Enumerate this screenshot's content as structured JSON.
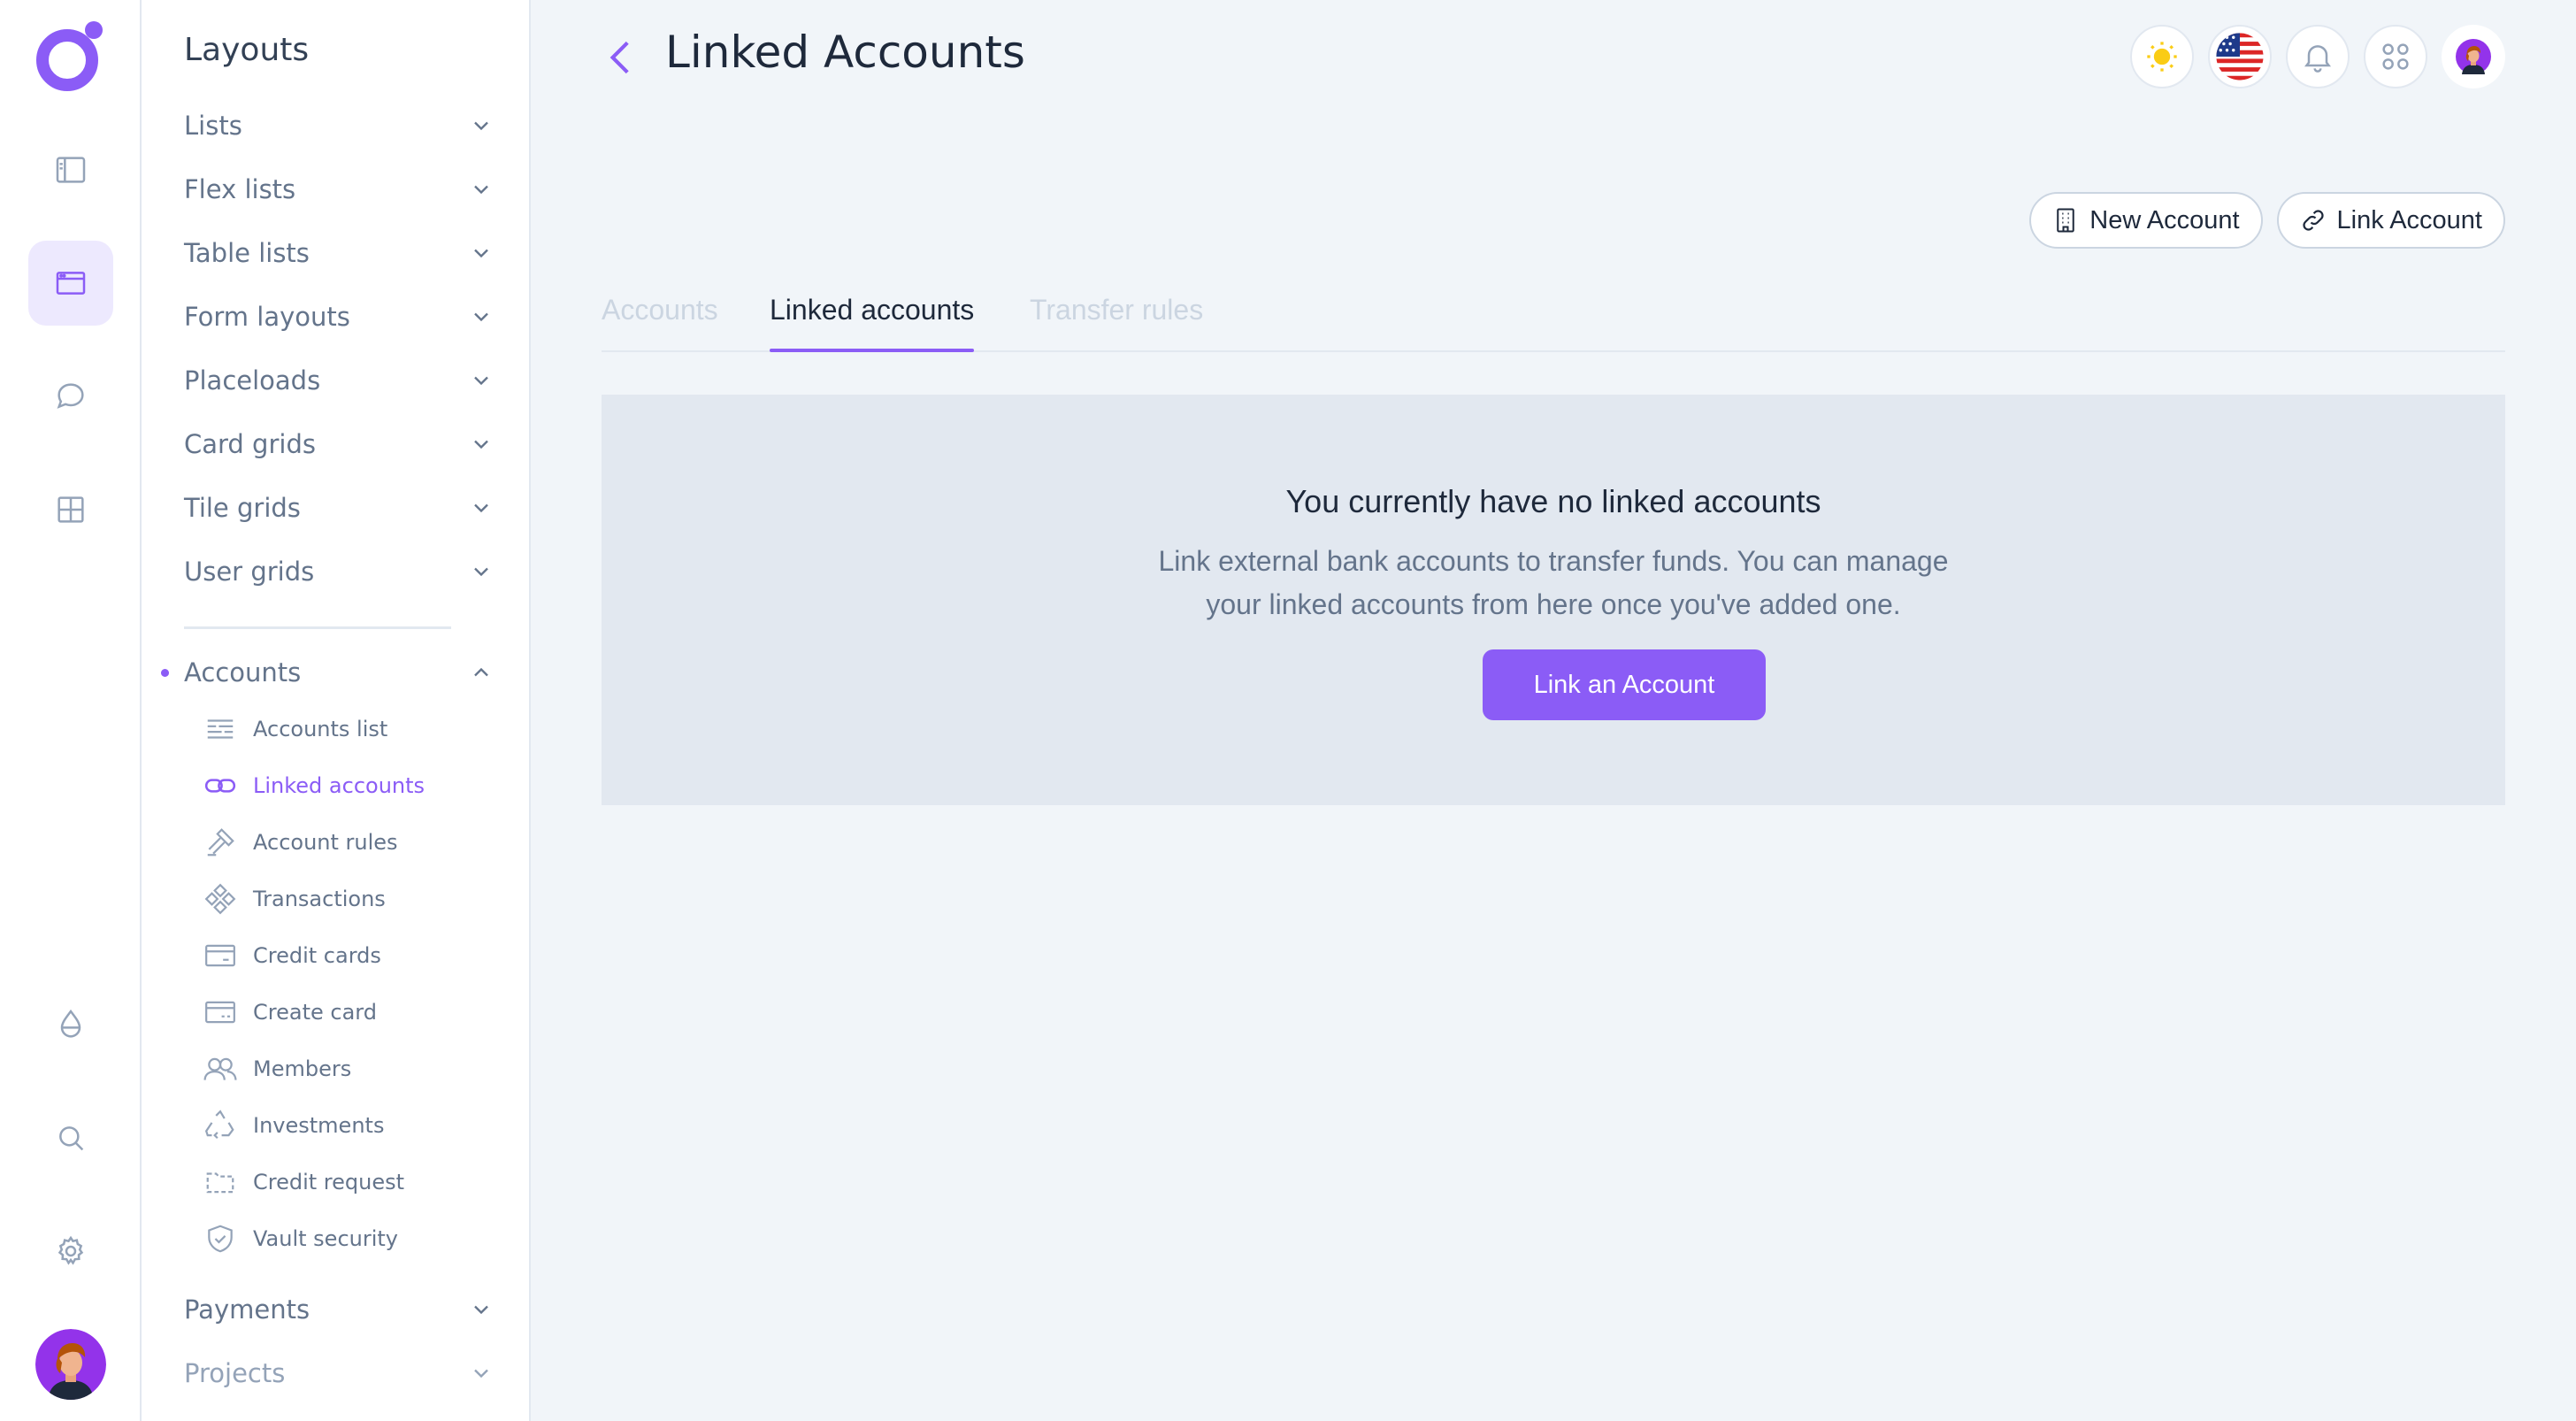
{
  "rail": {
    "icons": [
      "sidebar-icon",
      "layout-icon",
      "chat-icon",
      "grid-icon",
      "drop-icon",
      "search-icon",
      "gear-icon"
    ]
  },
  "sidebar": {
    "title": "Layouts",
    "items": [
      {
        "label": "Lists"
      },
      {
        "label": "Flex lists"
      },
      {
        "label": "Table lists"
      },
      {
        "label": "Form layouts"
      },
      {
        "label": "Placeloads"
      },
      {
        "label": "Card grids"
      },
      {
        "label": "Tile grids"
      },
      {
        "label": "User grids"
      }
    ],
    "accounts_section": {
      "label": "Accounts",
      "subitems": [
        {
          "label": "Accounts list",
          "icon": "list-icon"
        },
        {
          "label": "Linked accounts",
          "icon": "link-icon",
          "active": true
        },
        {
          "label": "Account rules",
          "icon": "gavel-icon"
        },
        {
          "label": "Transactions",
          "icon": "transactions-icon"
        },
        {
          "label": "Credit cards",
          "icon": "credit-card-icon"
        },
        {
          "label": "Create card",
          "icon": "create-card-icon"
        },
        {
          "label": "Members",
          "icon": "members-icon"
        },
        {
          "label": "Investments",
          "icon": "recycle-icon"
        },
        {
          "label": "Credit request",
          "icon": "folder-icon"
        },
        {
          "label": "Vault security",
          "icon": "shield-icon"
        }
      ]
    },
    "bottom_items": [
      {
        "label": "Payments"
      },
      {
        "label": "Projects"
      }
    ]
  },
  "header": {
    "title": "Linked Accounts"
  },
  "actions": {
    "new_account": "New Account",
    "link_account": "Link Account"
  },
  "tabs": [
    {
      "label": "Accounts",
      "state": "muted"
    },
    {
      "label": "Linked accounts",
      "state": "active"
    },
    {
      "label": "Transfer rules",
      "state": "muted"
    }
  ],
  "empty_state": {
    "title": "You currently have no linked accounts",
    "line1": "Link external bank accounts to transfer funds. You can manage",
    "line2": "your linked accounts from here once you've added one.",
    "cta": "Link an Account"
  },
  "colors": {
    "accent": "#8b5cf6",
    "panel": "#e2e8f0",
    "background": "#f1f5f9"
  }
}
